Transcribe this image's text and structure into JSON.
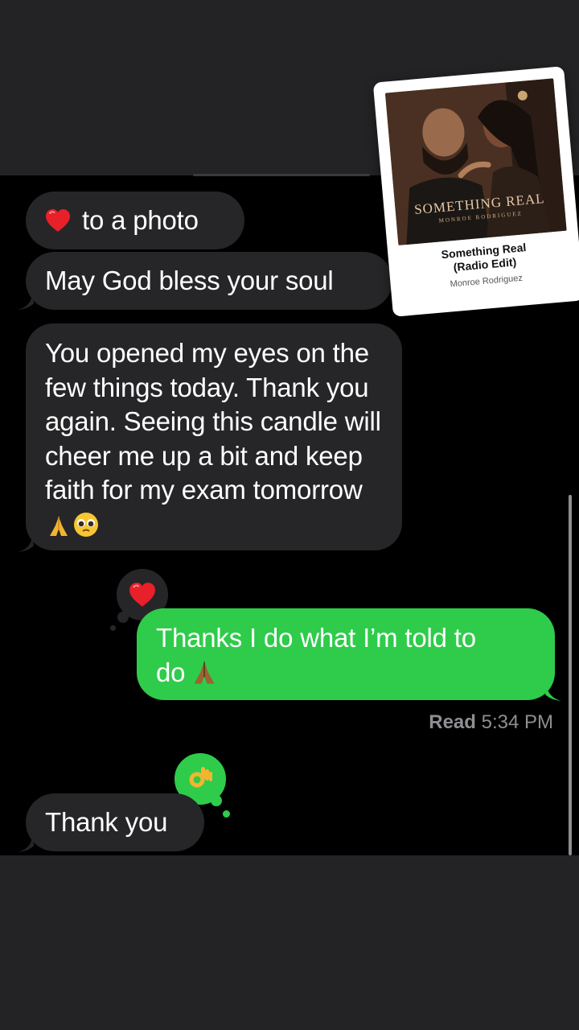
{
  "messages": {
    "reaction_note": "to a photo",
    "blessing": "May God bless your soul",
    "long_message": "You opened my eyes on the few things today. Thank you again. Seeing this candle will cheer me up a bit and keep faith for my exam tomorrow",
    "long_message_emojis": "🙏🥺",
    "sent_reply_line1": "Thanks I do what I’m told to",
    "sent_reply_line2": "do",
    "thank_you": "Thank you"
  },
  "receipt": {
    "status": "Read",
    "time": "5:34 PM"
  },
  "reactions": {
    "on_sent": "heart",
    "on_thank_you": "ok-hand"
  },
  "sticker": {
    "art_title": "SOMETHING REAL",
    "art_subtitle": "MONROE RODRIGUEZ",
    "song_title": "Something Real (Radio Edit)",
    "artist": "Monroe Rodriguez"
  },
  "colors": {
    "incoming_bubble": "#262628",
    "outgoing_bubble": "#2ecc4a",
    "background": "#000000",
    "band": "#232325"
  }
}
